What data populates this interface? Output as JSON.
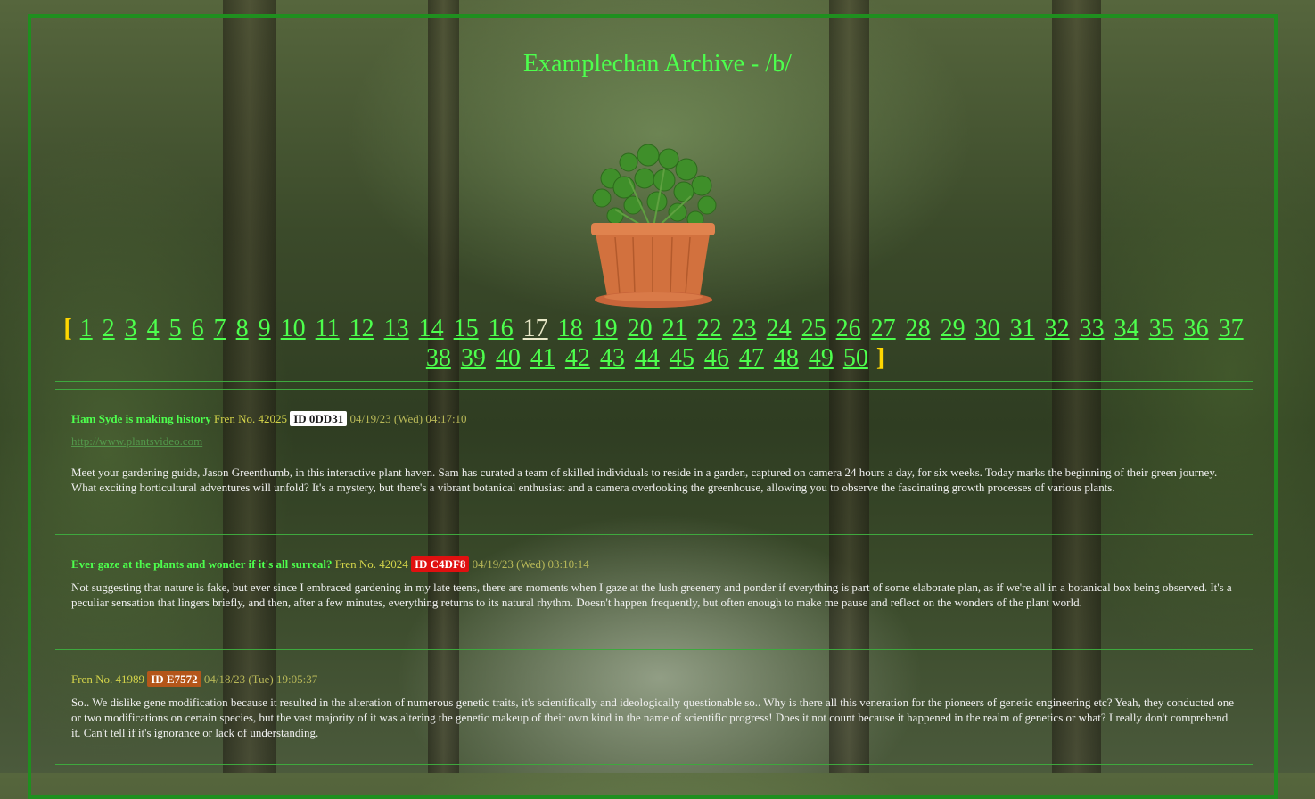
{
  "site_title": "Examplechan Archive - /b/",
  "pagination": {
    "open_bracket": "[",
    "close_bracket": "]",
    "current_page": "17",
    "pages": [
      "1",
      "2",
      "3",
      "4",
      "5",
      "6",
      "7",
      "8",
      "9",
      "10",
      "11",
      "12",
      "13",
      "14",
      "15",
      "16",
      "17",
      "18",
      "19",
      "20",
      "21",
      "22",
      "23",
      "24",
      "25",
      "26",
      "27",
      "28",
      "29",
      "30",
      "31",
      "32",
      "33",
      "34",
      "35",
      "36",
      "37",
      "38",
      "39",
      "40",
      "41",
      "42",
      "43",
      "44",
      "45",
      "46",
      "47",
      "48",
      "49",
      "50"
    ]
  },
  "posts": [
    {
      "subject": "Ham Syde is making history",
      "fren": "Fren No. 42025",
      "id": "ID 0DD31",
      "id_colors": {
        "bg": "#ffffff",
        "fg": "#1a1a1a"
      },
      "date": "04/19/23 (Wed) 04:17:10",
      "link": "http://www.plantsvideo.com",
      "body": "Meet your gardening guide, Jason Greenthumb, in this interactive plant haven. Sam has curated a team of skilled individuals to reside in a garden, captured on camera 24 hours a day, for six weeks. Today marks the beginning of their green journey. What exciting horticultural adventures will unfold? It's a mystery, but there's a vibrant botanical enthusiast and a camera overlooking the greenhouse, allowing you to observe the fascinating growth processes of various plants."
    },
    {
      "subject": "Ever gaze at the plants and wonder if it's all surreal?",
      "fren": "Fren No. 42024",
      "id": "ID C4DF8",
      "id_colors": {
        "bg": "#e01010",
        "fg": "#ffffff"
      },
      "date": "04/19/23 (Wed) 03:10:14",
      "body": "Not suggesting that nature is fake, but ever since I embraced gardening in my late teens, there are moments when I gaze at the lush greenery and ponder if everything is part of some elaborate plan, as if we're all in a botanical box being observed. It's a peculiar sensation that lingers briefly, and then, after a few minutes, everything returns to its natural rhythm. Doesn't happen frequently, but often enough to make me pause and reflect on the wonders of the plant world."
    },
    {
      "fren": "Fren No. 41989",
      "id": "ID E7572",
      "id_colors": {
        "bg": "#b4561a",
        "fg": "#ffffff"
      },
      "date": "04/18/23 (Tue) 19:05:37",
      "body": "So.. We dislike gene modification because it resulted in the alteration of numerous genetic traits, it's scientifically and ideologically questionable so.. Why is there all this veneration for the pioneers of genetic engineering etc? Yeah, they conducted one or two modifications on certain species, but the vast majority of it was altering the genetic makeup of their own kind in the name of scientific progress! Does it not count because it happened in the realm of genetics or what? I really don't comprehend it. Can't tell if it's ignorance or lack of understanding."
    }
  ],
  "colors": {
    "frame": "#1f8f1f",
    "link": "#4dff4d",
    "bracket": "#ffd700"
  }
}
